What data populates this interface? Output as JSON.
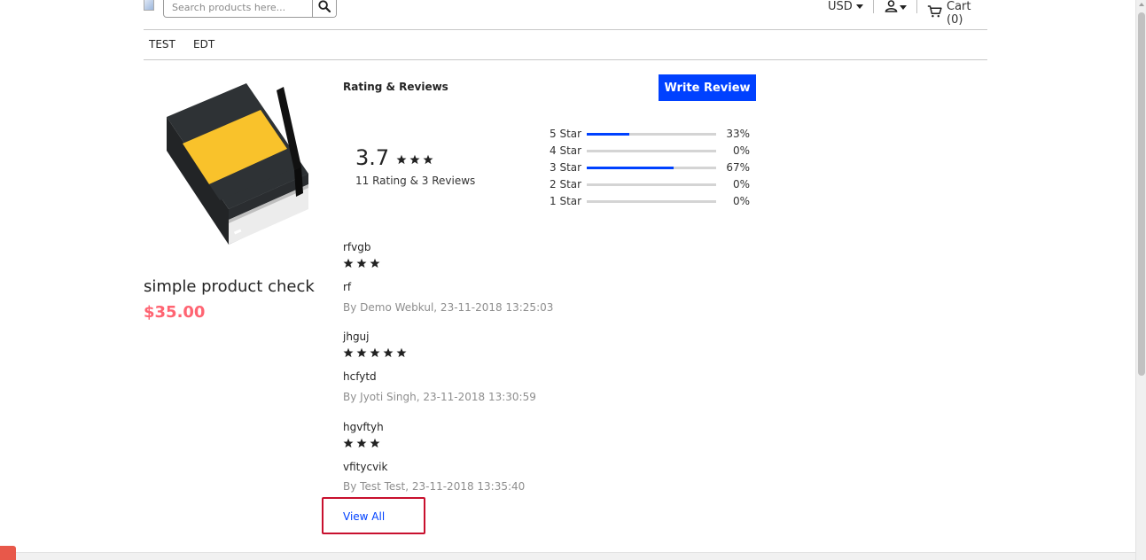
{
  "header": {
    "search": {
      "placeholder": "Search products here...",
      "value": ""
    },
    "currency": "USD",
    "cart_label": "Cart (0)"
  },
  "nav": {
    "items": [
      "TEST",
      "EDT"
    ]
  },
  "product": {
    "name": "simple product check",
    "price": "$35.00"
  },
  "reviews": {
    "section_title": "Rating & Reviews",
    "write_review_label": "Write Review",
    "average": "3.7",
    "average_stars": 3,
    "summary": "11 Rating & 3 Reviews",
    "distribution": [
      {
        "label": "5 Star",
        "percent_text": "33%",
        "fraction": 0.33
      },
      {
        "label": "4 Star",
        "percent_text": "0%",
        "fraction": 0
      },
      {
        "label": "3 Star",
        "percent_text": "67%",
        "fraction": 0.67
      },
      {
        "label": "2 Star",
        "percent_text": "0%",
        "fraction": 0
      },
      {
        "label": "1  Star",
        "percent_text": "0%",
        "fraction": 0
      }
    ],
    "items": [
      {
        "title": "rfvgb",
        "stars": 3,
        "body": "rf",
        "meta": "By Demo Webkul, 23-11-2018 13:25:03"
      },
      {
        "title": "jhguj",
        "stars": 5,
        "body": "hcfytd",
        "meta": "By Jyoti Singh, 23-11-2018 13:30:59"
      },
      {
        "title": "hgvftyh",
        "stars": 3,
        "body": "vfitycvik",
        "meta": "By Test Test, 23-11-2018 13:35:40"
      }
    ],
    "view_all_label": "View All"
  },
  "colors": {
    "accent_blue": "#0041ff",
    "price_red": "#ff6472",
    "highlight_red": "#c8102e"
  },
  "icons": {
    "search": "search-icon",
    "account": "user-icon",
    "cart": "cart-icon",
    "star": "star-icon"
  }
}
